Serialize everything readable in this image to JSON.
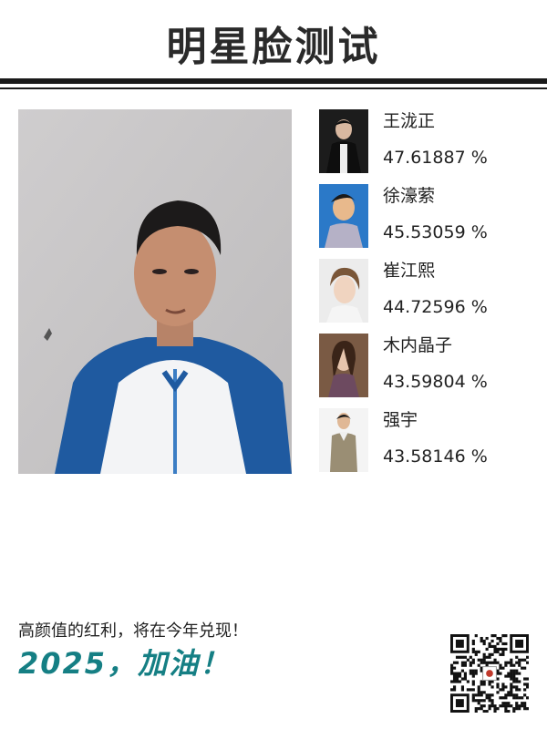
{
  "header": {
    "title": "明星脸测试"
  },
  "footer": {
    "tagline": "高颜值的红利，将在今年兑现！",
    "slogan": "2025，加油！"
  },
  "matches": [
    {
      "name": "王泷正",
      "score": "47.61887 %"
    },
    {
      "name": "徐濠萦",
      "score": "45.53059 %"
    },
    {
      "name": "崔江熙",
      "score": "44.72596 %"
    },
    {
      "name": "木内晶子",
      "score": "43.59804 %"
    },
    {
      "name": "强宇",
      "score": "43.58146 %"
    }
  ],
  "colors": {
    "accent": "#157f84",
    "rule": "#1a1a1a"
  },
  "icons": {
    "qr": "qr-code-icon"
  }
}
